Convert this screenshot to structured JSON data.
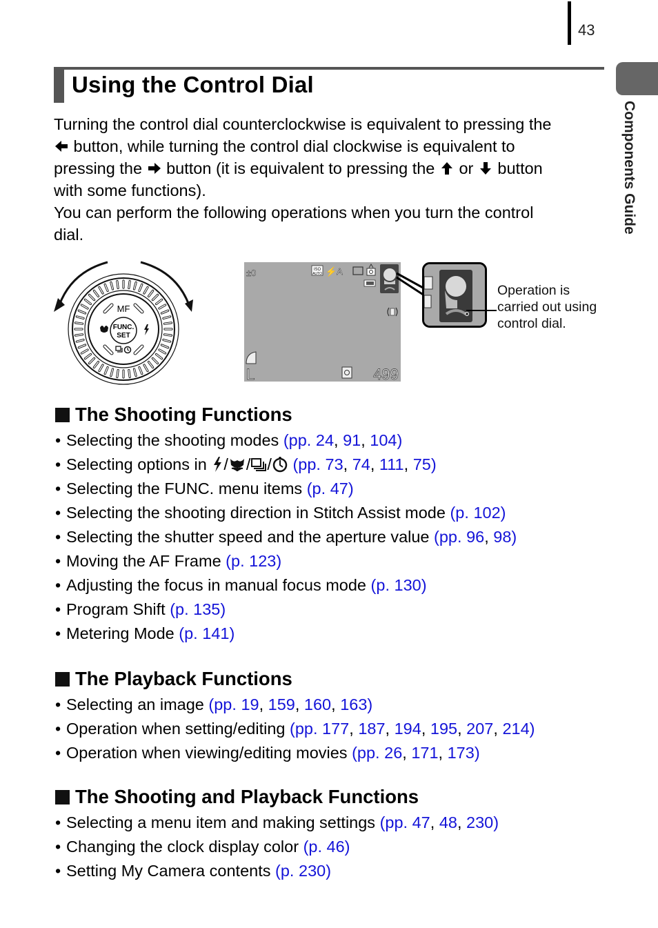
{
  "header": {
    "page_number": "43",
    "side_tab_label": "Components Guide"
  },
  "title": "Using the Control Dial",
  "intro": {
    "line1": "Turning the control dial counterclockwise is equivalent to pressing the",
    "line2_after_left_arrow": " button, while turning the control dial clockwise is equivalent to",
    "line3_before_right_arrow": "pressing the ",
    "line3_after_right_arrow": " button (it is equivalent to pressing the ",
    "line3_or": " or ",
    "line3_button": " button",
    "line4": "with some functions).",
    "line5": "You can perform the following operations when you turn the control",
    "line6": "dial."
  },
  "figure": {
    "dial_labels": {
      "top": "MF",
      "center_line1": "FUNC.",
      "center_line2": "SET"
    },
    "lcd": {
      "exposure": "±0",
      "iso": "ISO AUTO",
      "flash": "⚡A",
      "shots_remaining": "499",
      "size": "L"
    },
    "callout": "Operation is carried out using control dial."
  },
  "sections": [
    {
      "heading": "The Shooting Functions",
      "items": [
        {
          "text": "Selecting the shooting modes ",
          "refs_prefix": "(pp. ",
          "refs": [
            "24",
            "91",
            "104"
          ]
        },
        {
          "text": "Selecting options in ",
          "icons": [
            "flash-icon",
            "macro-icon",
            "continuous-icon",
            "self-timer-icon"
          ],
          "refs_prefix": "(pp. ",
          "refs": [
            "73",
            "74",
            "111",
            "75"
          ]
        },
        {
          "text": "Selecting the FUNC. menu items ",
          "refs_prefix": "(p. ",
          "refs": [
            "47"
          ]
        },
        {
          "text": "Selecting the shooting direction in Stitch Assist mode ",
          "refs_prefix": "(p. ",
          "refs": [
            "102"
          ]
        },
        {
          "text": "Selecting the shutter speed and the aperture value ",
          "refs_prefix": "(pp. ",
          "refs": [
            "96",
            "98"
          ]
        },
        {
          "text": "Moving the AF Frame ",
          "refs_prefix": "(p. ",
          "refs": [
            "123"
          ]
        },
        {
          "text": "Adjusting the focus in manual focus mode ",
          "refs_prefix": "(p. ",
          "refs": [
            "130"
          ]
        },
        {
          "text": "Program Shift ",
          "refs_prefix": "(p. ",
          "refs": [
            "135"
          ]
        },
        {
          "text": "Metering Mode ",
          "refs_prefix": "(p. ",
          "refs": [
            "141"
          ]
        }
      ]
    },
    {
      "heading": "The Playback Functions",
      "items": [
        {
          "text": "Selecting an image ",
          "refs_prefix": "(pp. ",
          "refs": [
            "19",
            "159",
            "160",
            "163"
          ]
        },
        {
          "text": "Operation when setting/editing ",
          "refs_prefix": "(pp. ",
          "refs": [
            "177",
            "187",
            "194",
            "195",
            "207",
            "214"
          ]
        },
        {
          "text": "Operation when viewing/editing movies ",
          "refs_prefix": "(pp. ",
          "refs": [
            "26",
            "171",
            "173"
          ]
        }
      ]
    },
    {
      "heading": "The Shooting and Playback Functions",
      "items": [
        {
          "text": "Selecting a menu item and making settings ",
          "refs_prefix": "(pp. ",
          "refs": [
            "47",
            "48",
            "230"
          ]
        },
        {
          "text": "Changing the clock display color ",
          "refs_prefix": "(p. ",
          "refs": [
            "46"
          ]
        },
        {
          "text": "Setting My Camera contents ",
          "refs_prefix": "(p. ",
          "refs": [
            "230"
          ]
        }
      ]
    }
  ],
  "colors": {
    "link": "#1414d8",
    "accent_gray": "#555555",
    "tab_gray": "#666666"
  }
}
